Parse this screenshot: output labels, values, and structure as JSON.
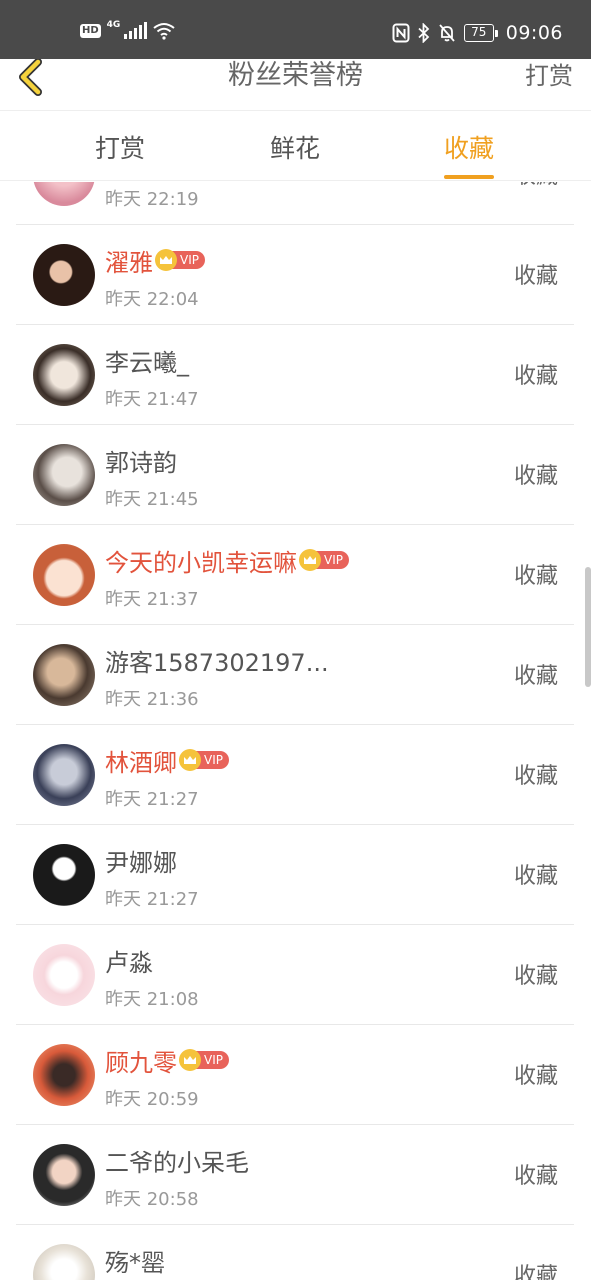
{
  "status_bar": {
    "hd": "HD",
    "network": "4G",
    "battery": "75",
    "time": "09:06"
  },
  "header": {
    "title": "粉丝荣誉榜",
    "action_label": "打赏"
  },
  "tabs": [
    {
      "label": "打赏"
    },
    {
      "label": "鲜花"
    },
    {
      "label": "收藏"
    }
  ],
  "active_tab": "收藏",
  "accent_color": "#f0a020",
  "vip_name_color": "#e2533c",
  "vip_label": "VIP",
  "list": [
    {
      "name": "",
      "time": "昨天 22:19",
      "action": "收藏",
      "vip": false
    },
    {
      "name": "濯雅",
      "time": "昨天 22:04",
      "action": "收藏",
      "vip": true
    },
    {
      "name": "李云曦_",
      "time": "昨天 21:47",
      "action": "收藏",
      "vip": false
    },
    {
      "name": "郭诗韵",
      "time": "昨天 21:45",
      "action": "收藏",
      "vip": false
    },
    {
      "name": "今天的小凯幸运嘛",
      "time": "昨天 21:37",
      "action": "收藏",
      "vip": true
    },
    {
      "name": "游客1587302197...",
      "time": "昨天 21:36",
      "action": "收藏",
      "vip": false
    },
    {
      "name": "林酒卿",
      "time": "昨天 21:27",
      "action": "收藏",
      "vip": true
    },
    {
      "name": "尹娜娜",
      "time": "昨天 21:27",
      "action": "收藏",
      "vip": false
    },
    {
      "name": "卢淼",
      "time": "昨天 21:08",
      "action": "收藏",
      "vip": false
    },
    {
      "name": "顾九零",
      "time": "昨天 20:59",
      "action": "收藏",
      "vip": true
    },
    {
      "name": "二爷的小呆毛",
      "time": "昨天 20:58",
      "action": "收藏",
      "vip": false
    },
    {
      "name": "殇*罂",
      "time": "",
      "action": "收藏",
      "vip": false
    }
  ]
}
